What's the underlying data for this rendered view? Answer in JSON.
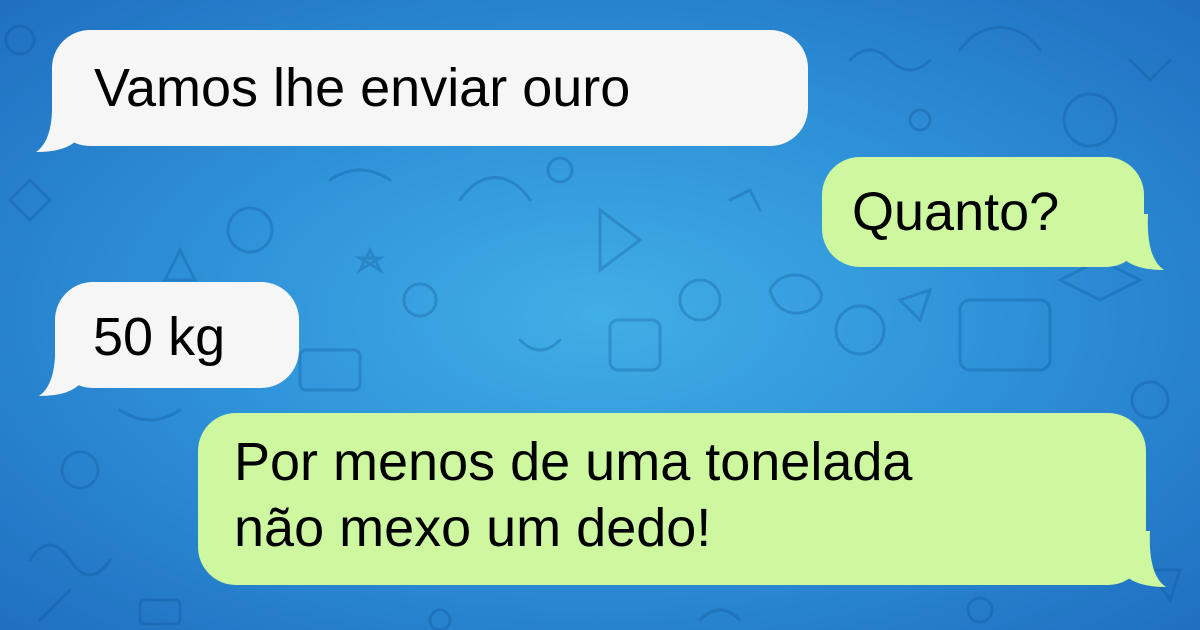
{
  "chat": {
    "background_color": "#2f93d9",
    "incoming_bubble_color": "#f6f6f6",
    "outgoing_bubble_color": "#cdf8a0",
    "messages": [
      {
        "direction": "incoming",
        "text": "Vamos lhe enviar ouro"
      },
      {
        "direction": "outgoing",
        "text": "Quanto?"
      },
      {
        "direction": "incoming",
        "text": "50 kg"
      },
      {
        "direction": "outgoing",
        "lines": [
          "Por menos de uma tonelada",
          "não mexo um dedo!"
        ]
      }
    ]
  }
}
